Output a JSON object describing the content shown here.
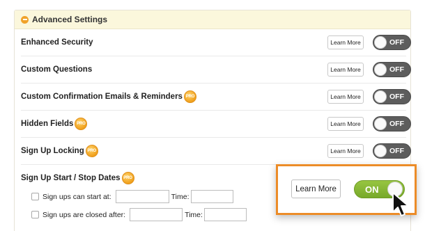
{
  "section": {
    "title": "Advanced Settings"
  },
  "settings": [
    {
      "label": "Enhanced Security",
      "pro": false,
      "learn_more": "Learn More",
      "toggle": "OFF"
    },
    {
      "label": "Custom Questions",
      "pro": false,
      "learn_more": "Learn More",
      "toggle": "OFF"
    },
    {
      "label": "Custom Confirmation Emails & Reminders",
      "pro": true,
      "learn_more": "Learn More",
      "toggle": "OFF"
    },
    {
      "label": "Hidden Fields",
      "pro": true,
      "learn_more": "Learn More",
      "toggle": "OFF"
    },
    {
      "label": "Sign Up Locking",
      "pro": true,
      "learn_more": "Learn More",
      "toggle": "OFF"
    }
  ],
  "pro_badge": "PRO",
  "dates": {
    "title": "Sign Up Start / Stop Dates",
    "start_label": "Sign ups can start at:",
    "closed_label": "Sign ups are closed after:",
    "time_label": "Time:",
    "start_value": "",
    "start_time": "",
    "closed_value": "",
    "closed_time": "",
    "learn_more": "Learn More",
    "toggle": "ON"
  },
  "colors": {
    "accent_orange": "#ec8c28",
    "toggle_on": "#86b735",
    "toggle_off": "#5d5d5d",
    "header_bg": "#fbf7dc"
  }
}
